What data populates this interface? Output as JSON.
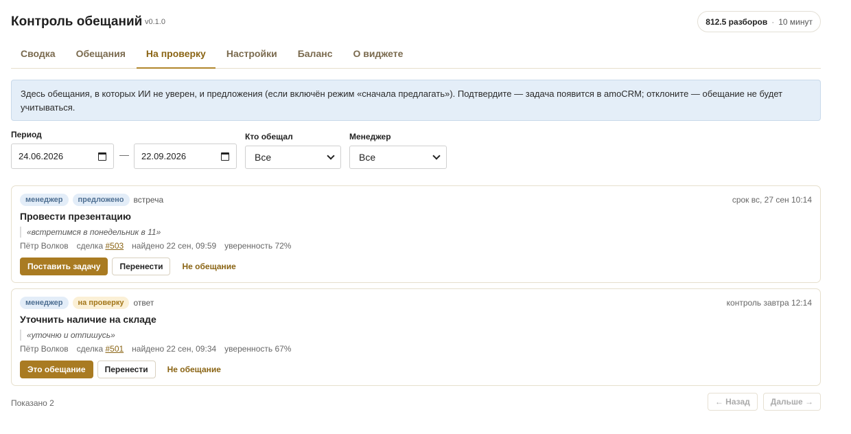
{
  "app": {
    "title": "Контроль обещаний",
    "version": "v0.1.0"
  },
  "balance": {
    "main": "812.5 разборов",
    "sep": "·",
    "minutes": "10 минут"
  },
  "tabs": [
    {
      "label": "Сводка"
    },
    {
      "label": "Обещания"
    },
    {
      "label": "На проверку"
    },
    {
      "label": "Настройки"
    },
    {
      "label": "Баланс"
    },
    {
      "label": "О виджете"
    }
  ],
  "active_tab": "На проверку",
  "info": "Здесь обещания, в которых ИИ не уверен, и предложения (если включён режим «сначала предлагать»). Подтвердите — задача появится в amoCRM; отклоните — обещание не будет учитываться.",
  "filters": {
    "period_label": "Период",
    "date_from": "24.06.2026",
    "date_to": "22.09.2026",
    "dash": "—",
    "who_label": "Кто обещал",
    "who_value": "Все",
    "manager_label": "Менеджер",
    "manager_value": "Все"
  },
  "cards": [
    {
      "badge1": "менеджер",
      "badge2": "предложено",
      "kind": "встреча",
      "deadline": "срок вс, 27 сен 10:14",
      "title": "Провести презентацию",
      "quote": "«встретимся в понедельник в 11»",
      "person": "Пётр Волков",
      "deal_label": "сделка",
      "deal_link": "#503",
      "found": "найдено 22 сен, 09:59",
      "confidence": "уверенность 72%",
      "btn_primary": "Поставить задачу",
      "btn_outline": "Перенести",
      "btn_link": "Не обещание"
    },
    {
      "badge1": "менеджер",
      "badge2": "на проверку",
      "kind": "ответ",
      "deadline": "контроль завтра 12:14",
      "title": "Уточнить наличие на складе",
      "quote": "«уточню и отпишусь»",
      "person": "Пётр Волков",
      "deal_label": "сделка",
      "deal_link": "#501",
      "found": "найдено 22 сен, 09:34",
      "confidence": "уверенность 67%",
      "btn_primary": "Это обещание",
      "btn_outline": "Перенести",
      "btn_link": "Не обещание"
    }
  ],
  "footer": {
    "shown": "Показано 2",
    "prev": "← Назад",
    "next": "Дальше →"
  },
  "colors": {
    "accent": "#a97b22",
    "info_bg": "#e4eef8",
    "badge_blue": "#e3edf8",
    "badge_amber": "#fbf0d6"
  }
}
